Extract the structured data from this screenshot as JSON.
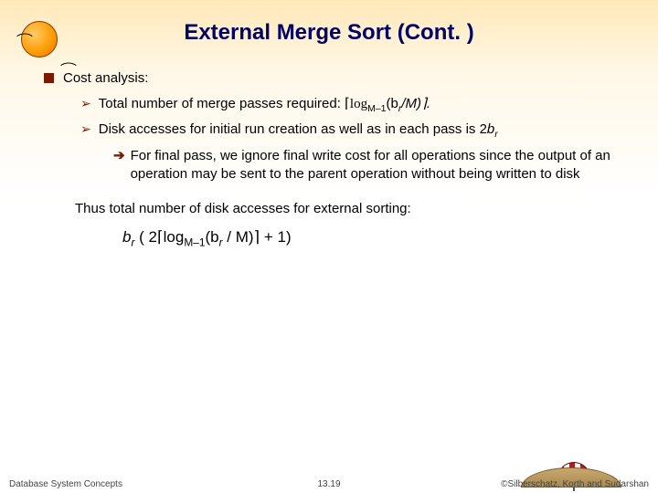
{
  "title": "External Merge Sort (Cont. )",
  "bullets": {
    "cost": "Cost analysis:",
    "passes_prefix": "Total number of merge passes required: ",
    "passes_formula": "⌈log",
    "passes_sub": "M–1",
    "passes_mid": "(b",
    "passes_r": "r",
    "passes_tail": "/M)⌉.",
    "disk_prefix": "Disk accesses for initial run creation as well as in each pass is 2",
    "disk_b": "b",
    "disk_r": "r",
    "final": "For final pass, we ignore final write cost for all operations since the output of an operation may be sent to the parent operation without being written to disk"
  },
  "thus": "Thus total number of disk accesses for external sorting:",
  "formula": {
    "p1": "b",
    "p2": "r",
    "p3": " ( 2⌈log",
    "p4": "M–1",
    "p5": "(b",
    "p6": "r",
    "p7": " / M)⌉ + 1)"
  },
  "footer": {
    "left": "Database System Concepts",
    "mid": "13.19",
    "right": "©Silberschatz, Korth and Sudarshan"
  }
}
